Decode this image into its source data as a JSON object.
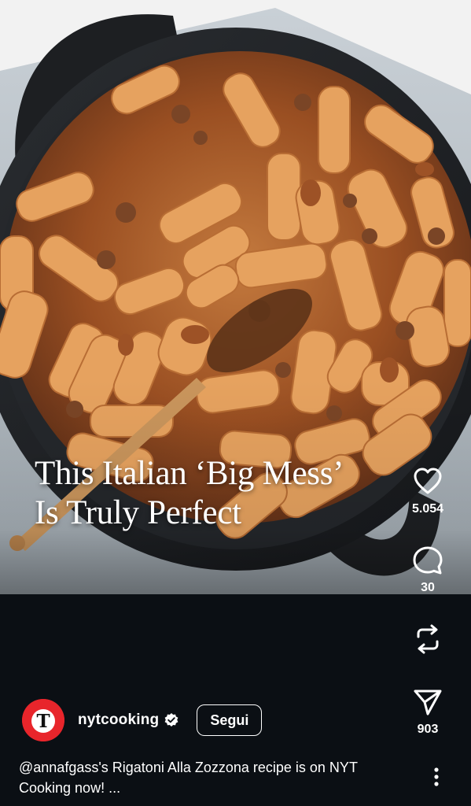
{
  "post": {
    "overlay_title_line1": "This Italian ‘Big Mess’",
    "overlay_title_line2": "Is Truly Perfect"
  },
  "actions": {
    "like": {
      "icon": "heart-icon",
      "count": "5.054"
    },
    "comment": {
      "icon": "comment-icon",
      "count": "30"
    },
    "repost": {
      "icon": "repost-icon"
    },
    "share": {
      "icon": "send-icon",
      "count": "903"
    },
    "more": {
      "icon": "more-vertical-icon"
    }
  },
  "author": {
    "avatar_letter": "T",
    "username": "nytcooking",
    "follow_label": "Segui"
  },
  "caption": {
    "mention": "@annafgass",
    "text": "'s Rigatoni Alla Zozzona recipe is on NYT Cooking now! ..."
  },
  "colors": {
    "background": "#0b0f14",
    "avatar": "#e8252b",
    "text": "#ffffff"
  }
}
